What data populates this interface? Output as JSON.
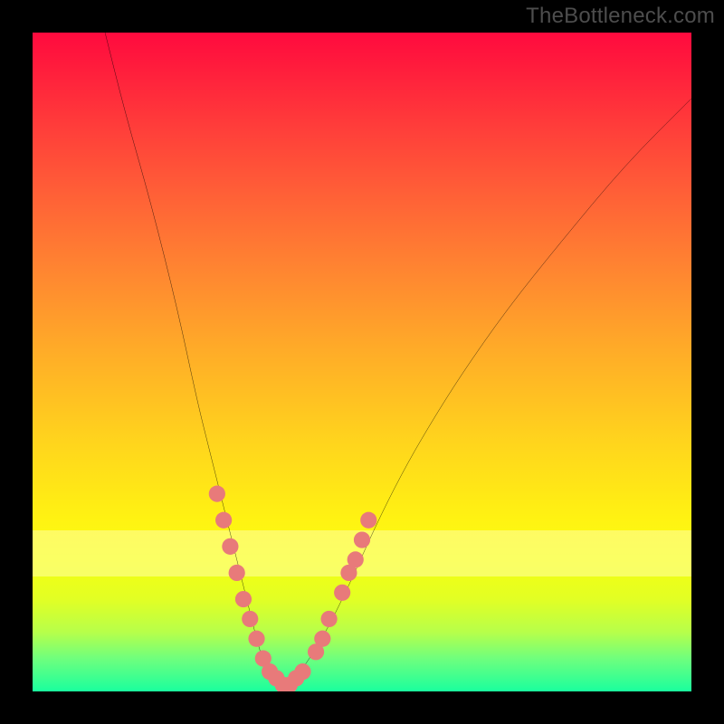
{
  "watermark": "TheBottleneck.com",
  "colors": {
    "frame": "#000000",
    "curve_stroke": "#000000",
    "marker_fill": "#e87a7a",
    "gradient_stops": [
      "#ff0a3e",
      "#ff8531",
      "#ffd41d",
      "#f6ff10",
      "#1aff9e"
    ]
  },
  "chart_data": {
    "type": "line",
    "title": "",
    "xlabel": "",
    "ylabel": "",
    "xlim": [
      0,
      100
    ],
    "ylim": [
      0,
      100
    ],
    "series": [
      {
        "name": "bottleneck-curve",
        "x": [
          11,
          14,
          18,
          22,
          25,
          27,
          29,
          31,
          33,
          34.5,
          36,
          38,
          40,
          44,
          48,
          52,
          56,
          60,
          65,
          72,
          80,
          90,
          100
        ],
        "y": [
          100,
          88,
          74,
          58,
          44,
          36,
          28,
          20,
          12,
          6,
          2,
          0,
          2,
          8,
          16,
          25,
          33,
          40,
          48,
          58,
          68,
          80,
          90
        ]
      }
    ],
    "markers": {
      "name": "highlight-points",
      "x": [
        28,
        29,
        30,
        31,
        32,
        33,
        34,
        35,
        36,
        37,
        38,
        39,
        40,
        41,
        43,
        44,
        45,
        47,
        48,
        49,
        50,
        51
      ],
      "y": [
        30,
        26,
        22,
        18,
        14,
        11,
        8,
        5,
        3,
        2,
        1,
        1,
        2,
        3,
        6,
        8,
        11,
        15,
        18,
        20,
        23,
        26
      ]
    }
  }
}
